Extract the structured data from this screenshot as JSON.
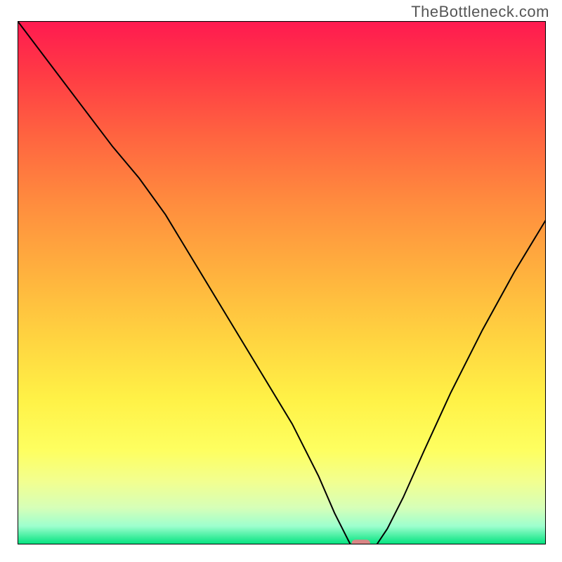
{
  "watermark": "TheBottleneck.com",
  "chart_data": {
    "type": "line",
    "title": "",
    "xlabel": "",
    "ylabel": "",
    "xlim": [
      0,
      100
    ],
    "ylim": [
      0,
      100
    ],
    "background": {
      "description": "vertical rainbow gradient from red (top) through orange, yellow to green (bottom)",
      "stops": [
        {
          "offset": 0.0,
          "color": "#ff1a50"
        },
        {
          "offset": 0.1,
          "color": "#ff3a45"
        },
        {
          "offset": 0.22,
          "color": "#ff6440"
        },
        {
          "offset": 0.35,
          "color": "#ff8d3e"
        },
        {
          "offset": 0.48,
          "color": "#ffb13e"
        },
        {
          "offset": 0.6,
          "color": "#ffd240"
        },
        {
          "offset": 0.72,
          "color": "#fff146"
        },
        {
          "offset": 0.82,
          "color": "#feff60"
        },
        {
          "offset": 0.88,
          "color": "#f2ff90"
        },
        {
          "offset": 0.93,
          "color": "#d6ffb8"
        },
        {
          "offset": 0.965,
          "color": "#9dffce"
        },
        {
          "offset": 1.0,
          "color": "#00e27e"
        }
      ]
    },
    "series": [
      {
        "name": "bottleneck-curve",
        "color": "#000000",
        "stroke_width": 2,
        "x": [
          0,
          6,
          12,
          18,
          23,
          28,
          34,
          40,
          46,
          52,
          57,
          60,
          62,
          63,
          66,
          68,
          70,
          73,
          77,
          82,
          88,
          94,
          100
        ],
        "y": [
          100,
          92,
          84,
          76,
          70,
          63,
          53,
          43,
          33,
          23,
          13,
          6,
          2,
          0,
          0,
          0,
          3,
          9,
          18,
          29,
          41,
          52,
          62
        ]
      }
    ],
    "marker": {
      "name": "optimal-point",
      "x": 65,
      "y": 0,
      "shape": "rounded-rect",
      "fill": "#d98585",
      "width_frac": 0.035,
      "height_frac": 0.018
    },
    "axes": {
      "show_ticks": false,
      "show_grid": false,
      "frame_color": "#000000",
      "frame_width": 2
    }
  }
}
